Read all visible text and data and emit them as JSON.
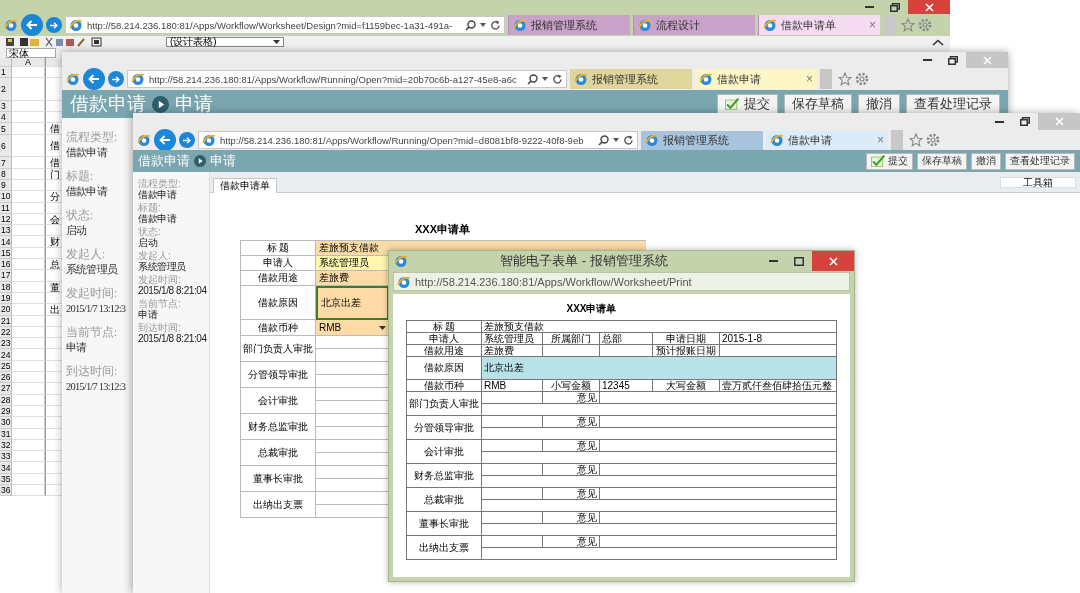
{
  "design_window": {
    "url": "http://58.214.236.180:81/Apps/Workflow/Worksheet/Design?mid=f1159bec-1a31-491a-",
    "tabs": [
      {
        "label": "报销管理系统",
        "selected": false
      },
      {
        "label": "流程设计",
        "selected": false
      },
      {
        "label": "借款申请单",
        "selected": true,
        "close": "×"
      }
    ],
    "style_select": "(设计表格)",
    "font_field": "宋体",
    "column_header": "A",
    "rows": [
      {
        "number": "1",
        "tall": false
      },
      {
        "number": "2",
        "tall": true
      },
      {
        "number": "3",
        "tall": false
      },
      {
        "number": "4",
        "tall": false
      },
      {
        "number": "5",
        "tall": false,
        "text": "借"
      },
      {
        "number": "6",
        "tall": true,
        "text": "借"
      },
      {
        "number": "7",
        "tall": false,
        "text": "借"
      },
      {
        "number": "8",
        "tall": false,
        "text": "门"
      },
      {
        "number": "9",
        "tall": false
      },
      {
        "number": "10",
        "tall": false,
        "text": "分"
      },
      {
        "number": "11",
        "tall": false
      },
      {
        "number": "12",
        "tall": false,
        "text": "会"
      },
      {
        "number": "13",
        "tall": false
      },
      {
        "number": "14",
        "tall": false,
        "text": "财"
      },
      {
        "number": "15",
        "tall": false
      },
      {
        "number": "16",
        "tall": false,
        "text": "总"
      },
      {
        "number": "17",
        "tall": false
      },
      {
        "number": "18",
        "tall": false,
        "text": "董"
      },
      {
        "number": "19",
        "tall": false
      },
      {
        "number": "20",
        "tall": false,
        "text": "出"
      },
      {
        "number": "21",
        "tall": false
      },
      {
        "number": "22",
        "tall": false
      },
      {
        "number": "23",
        "tall": false
      },
      {
        "number": "24",
        "tall": false
      },
      {
        "number": "25",
        "tall": false
      },
      {
        "number": "26",
        "tall": false
      },
      {
        "number": "27",
        "tall": false
      },
      {
        "number": "28",
        "tall": false
      },
      {
        "number": "29",
        "tall": false
      },
      {
        "number": "30",
        "tall": false
      },
      {
        "number": "31",
        "tall": false
      },
      {
        "number": "32",
        "tall": false
      },
      {
        "number": "33",
        "tall": false
      },
      {
        "number": "34",
        "tall": false
      },
      {
        "number": "35",
        "tall": false
      },
      {
        "number": "36",
        "tall": false
      }
    ]
  },
  "process_window": {
    "url": "http://58.214.236.180:81/Apps/Workflow/Running/Open?mid=20b70c6b-a127-45e8-a6c",
    "tabs": [
      {
        "label": "报销管理系统",
        "selected": false
      },
      {
        "label": "借款申请",
        "selected": true,
        "close": "×"
      }
    ],
    "header": {
      "title": "借款申请",
      "step": "申请"
    },
    "buttons": [
      {
        "label": "提交",
        "kind": "submit"
      },
      {
        "label": "保存草稿",
        "kind": "save"
      },
      {
        "label": "撤消",
        "kind": "revoke"
      },
      {
        "label": "查看处理记录",
        "kind": "history"
      }
    ],
    "info": [
      {
        "label": "流程类型:",
        "value": "借款申请"
      },
      {
        "label": "标题:",
        "value": "借款申请"
      },
      {
        "label": "状态:",
        "value": "启动"
      },
      {
        "label": "发起人:",
        "value": "系统管理员"
      },
      {
        "label": "发起时间:",
        "value": "2015/1/7 13:12:3"
      },
      {
        "label": "当前节点:",
        "value": "申请"
      },
      {
        "label": "到达时间:",
        "value": "2015/1/7 13:12:3"
      }
    ]
  },
  "request_window": {
    "url": "http://58.214.236.180:81/Apps/Workflow/Running/Open?mid=d8081bf8-9222-40f8-9eb",
    "tabs": [
      {
        "label": "报销管理系统",
        "selected": false
      },
      {
        "label": "借款申请",
        "selected": true,
        "close": "×"
      }
    ],
    "header": {
      "title": "借款申请",
      "step": "申请"
    },
    "buttons": [
      {
        "label": "提交",
        "kind": "submit"
      },
      {
        "label": "保存草稿",
        "kind": "save"
      },
      {
        "label": "撤消",
        "kind": "revoke"
      },
      {
        "label": "查看处理记录",
        "kind": "history"
      }
    ],
    "toolbox": "工具箱",
    "info": [
      {
        "label": "流程类型:",
        "value": "借款申请"
      },
      {
        "label": "标题:",
        "value": "借款申请"
      },
      {
        "label": "状态:",
        "value": "启动"
      },
      {
        "label": "发起人:",
        "value": "系统管理员"
      },
      {
        "label": "发起时间:",
        "value": "2015/1/8 8:21:04"
      },
      {
        "label": "当前节点:",
        "value": "申请"
      },
      {
        "label": "到达时间:",
        "value": "2015/1/8 8:21:04"
      }
    ],
    "form_tab": {
      "label": "借款申请单",
      "selected": true
    },
    "form": {
      "title": "XXX申请单",
      "rows": [
        {
          "kind": "wide",
          "label": "标 题",
          "value": "差旅预支借款",
          "color": "#fddba6",
          "focused": false
        },
        {
          "kind": "text",
          "label": "申请人",
          "value": "系统管理员",
          "color": "#fdf7b0",
          "focused": false
        },
        {
          "kind": "text",
          "label": "借款用途",
          "value": "差旅费",
          "color": "#fddba6",
          "focused": false
        },
        {
          "kind": "area",
          "label": "借款原因",
          "value": "北京出差",
          "color": "#fddba6",
          "focused": true
        },
        {
          "kind": "select",
          "label": "借款币种",
          "value": "RMB",
          "color": "#fddba6",
          "focused": false
        }
      ],
      "approvals": [
        "部门负责人审批",
        "分管领导审批",
        "会计审批",
        "财务总监审批",
        "总裁审批",
        "董事长审批",
        "出纳出支票"
      ]
    }
  },
  "print_window": {
    "title": "智能电子表单 - 报销管理系统",
    "url": "http://58.214.236.180:81/Apps/Workflow/Worksheet/Print",
    "form": {
      "title": "XXX申请单",
      "rows": [
        {
          "kind": "wide",
          "cells": [
            "标 题",
            "差旅预支借款"
          ]
        },
        {
          "kind": "triple",
          "cells": [
            "申请人",
            "系统管理员",
            "所属部门",
            "总部",
            "申请日期",
            "2015-1-8"
          ]
        },
        {
          "kind": "pair",
          "cells": [
            "借款用途",
            "差旅费",
            "",
            "",
            "预计报账日期",
            ""
          ]
        },
        {
          "kind": "highlight",
          "cells": [
            "借款原因",
            "北京出差"
          ]
        },
        {
          "kind": "triple",
          "cells": [
            "借款币种",
            "RMB",
            "小写金额",
            "12345",
            "大写金额",
            "壹万贰仟叁佰肆拾伍元整"
          ]
        }
      ],
      "approvals": [
        {
          "label": "部门负责人审批",
          "opinion": "意见"
        },
        {
          "label": "分管领导审批",
          "opinion": "意见"
        },
        {
          "label": "会计审批",
          "opinion": "意见"
        },
        {
          "label": "财务总监审批",
          "opinion": "意见"
        },
        {
          "label": "总裁审批",
          "opinion": "意见"
        },
        {
          "label": "董事长审批",
          "opinion": "意见"
        },
        {
          "label": "出纳出支票",
          "opinion": "意见"
        }
      ]
    }
  }
}
